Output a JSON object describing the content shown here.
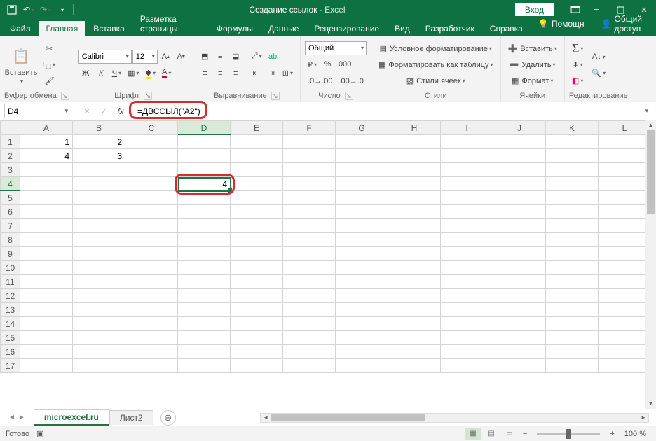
{
  "window": {
    "title_doc": "Создание ссылок",
    "title_app": "Excel",
    "login": "Вход"
  },
  "tabs": {
    "items": [
      "Файл",
      "Главная",
      "Вставка",
      "Разметка страницы",
      "Формулы",
      "Данные",
      "Рецензирование",
      "Вид",
      "Разработчик",
      "Справка"
    ],
    "help": "Помощн",
    "share": "Общий доступ"
  },
  "ribbon": {
    "clipboard": {
      "paste": "Вставить",
      "label": "Буфер обмена"
    },
    "font": {
      "name": "Calibri",
      "size": "12",
      "label": "Шрифт",
      "bold": "Ж",
      "italic": "К",
      "underline": "Ч"
    },
    "align": {
      "label": "Выравнивание"
    },
    "number": {
      "format": "Общий",
      "label": "Число",
      "percent": "%",
      "comma": "000"
    },
    "styles": {
      "cond": "Условное форматирование",
      "table": "Форматировать как таблицу",
      "cell": "Стили ячеек",
      "label": "Стили"
    },
    "cells": {
      "insert": "Вставить",
      "delete": "Удалить",
      "format": "Формат",
      "label": "Ячейки"
    },
    "editing": {
      "label": "Редактирование"
    }
  },
  "namebox": "D4",
  "formula": "=ДВССЫЛ(\"A2\")",
  "columns": [
    "A",
    "B",
    "C",
    "D",
    "E",
    "F",
    "G",
    "H",
    "I",
    "J",
    "K",
    "L"
  ],
  "rows": [
    "1",
    "2",
    "3",
    "4",
    "5",
    "6",
    "7",
    "8",
    "9",
    "10",
    "11",
    "12",
    "13",
    "14",
    "15",
    "16",
    "17"
  ],
  "cells": {
    "A1": "1",
    "B1": "2",
    "A2": "4",
    "B2": "3",
    "D4": "4"
  },
  "sheets": {
    "active": "microexcel.ru",
    "other": "Лист2"
  },
  "status": {
    "ready": "Готово",
    "zoom": "100 %"
  }
}
